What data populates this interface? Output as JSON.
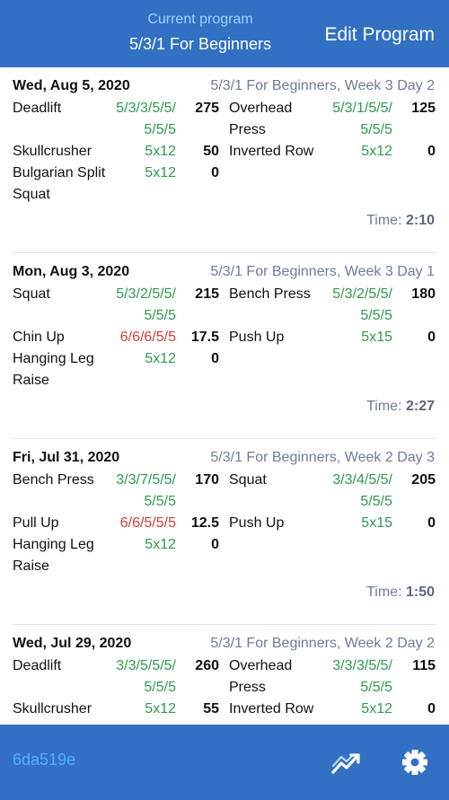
{
  "header": {
    "current_label": "Current program",
    "program_name": "5/3/1 For Beginners",
    "edit_label": "Edit Program"
  },
  "workouts": [
    {
      "date": "Wed, Aug 5, 2020",
      "program": "5/3/1 For Beginners, Week 3 Day 2",
      "time_label": "Time:",
      "time": "2:10",
      "exercises": [
        {
          "name": "Deadlift",
          "reps": "5/3/3/5/5/\n5/5/5",
          "weight": "275",
          "col": "L",
          "status": "ok"
        },
        {
          "name": "Overhead\nPress",
          "reps": "5/3/1/5/5/\n5/5/5",
          "weight": "125",
          "col": "R",
          "status": "ok"
        },
        {
          "name": "Skullcrusher",
          "reps": "5x12",
          "weight": "50",
          "col": "L",
          "status": "ok"
        },
        {
          "name": "Inverted Row",
          "reps": "5x12",
          "weight": "0",
          "col": "R",
          "status": "ok"
        },
        {
          "name": "Bulgarian Split\nSquat",
          "reps": "5x12",
          "weight": "0",
          "col": "L",
          "status": "ok"
        }
      ]
    },
    {
      "date": "Mon, Aug 3, 2020",
      "program": "5/3/1 For Beginners, Week 3 Day 1",
      "time_label": "Time:",
      "time": "2:27",
      "exercises": [
        {
          "name": "Squat",
          "reps": "5/3/2/5/5/\n5/5/5",
          "weight": "215",
          "col": "L",
          "status": "ok"
        },
        {
          "name": "Bench Press",
          "reps": "5/3/2/5/5/\n5/5/5",
          "weight": "180",
          "col": "R",
          "status": "ok"
        },
        {
          "name": "Chin Up",
          "reps": "6/6/6/5/5",
          "weight": "17.5",
          "col": "L",
          "status": "fail"
        },
        {
          "name": "Push Up",
          "reps": "5x15",
          "weight": "0",
          "col": "R",
          "status": "ok"
        },
        {
          "name": "Hanging Leg\nRaise",
          "reps": "5x12",
          "weight": "0",
          "col": "L",
          "status": "ok"
        }
      ]
    },
    {
      "date": "Fri, Jul 31, 2020",
      "program": "5/3/1 For Beginners, Week 2 Day 3",
      "time_label": "Time:",
      "time": "1:50",
      "exercises": [
        {
          "name": "Bench Press",
          "reps": "3/3/7/5/5/\n5/5/5",
          "weight": "170",
          "col": "L",
          "status": "ok"
        },
        {
          "name": "Squat",
          "reps": "3/3/4/5/5/\n5/5/5",
          "weight": "205",
          "col": "R",
          "status": "ok"
        },
        {
          "name": "Pull Up",
          "reps": "6/6/5/5/5",
          "weight": "12.5",
          "col": "L",
          "status": "fail"
        },
        {
          "name": "Push Up",
          "reps": "5x15",
          "weight": "0",
          "col": "R",
          "status": "ok"
        },
        {
          "name": "Hanging Leg\nRaise",
          "reps": "5x12",
          "weight": "0",
          "col": "L",
          "status": "ok"
        }
      ]
    },
    {
      "date": "Wed, Jul 29, 2020",
      "program": "5/3/1 For Beginners, Week 2 Day 2",
      "time_label": "",
      "time": "",
      "exercises": [
        {
          "name": "Deadlift",
          "reps": "3/3/5/5/5/\n5/5/5",
          "weight": "260",
          "col": "L",
          "status": "ok"
        },
        {
          "name": "Overhead\nPress",
          "reps": "3/3/3/5/5/\n5/5/5",
          "weight": "115",
          "col": "R",
          "status": "ok"
        },
        {
          "name": "Skullcrusher",
          "reps": "5x12",
          "weight": "55",
          "col": "L",
          "status": "ok"
        },
        {
          "name": "Inverted Row",
          "reps": "5x12",
          "weight": "0",
          "col": "R",
          "status": "ok"
        }
      ]
    }
  ],
  "footer": {
    "hash": "6da519e",
    "icons": [
      "chart-trend-icon",
      "gear-icon"
    ]
  },
  "colors": {
    "header_bg": "#3170c2",
    "reps_ok": "#2e9a4f",
    "reps_fail": "#d63a3a",
    "muted": "#6b7c99",
    "hash": "#58b1ff"
  }
}
